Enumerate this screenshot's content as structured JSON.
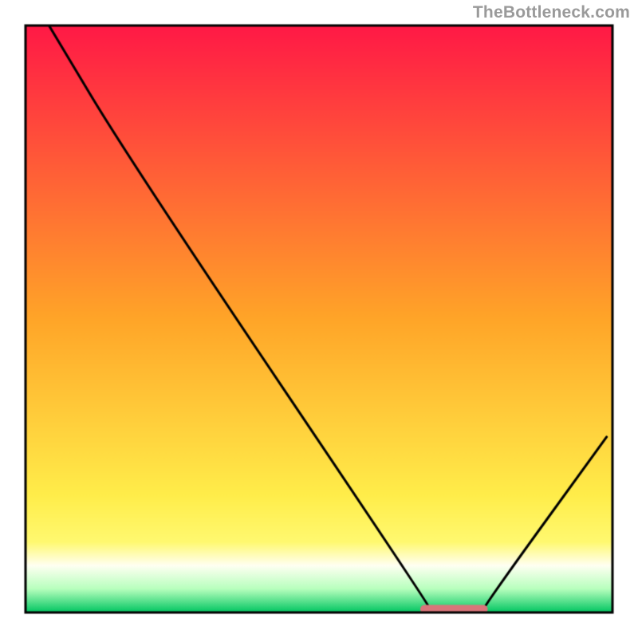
{
  "watermark": "TheBottleneck.com",
  "chart_data": {
    "type": "line",
    "title": "",
    "xlabel": "",
    "ylabel": "",
    "xlim": [
      0,
      100
    ],
    "ylim": [
      0,
      107
    ],
    "series": [
      {
        "name": "curve",
        "points": [
          {
            "x": 4,
            "y": 107
          },
          {
            "x": 18,
            "y": 82
          },
          {
            "x": 69,
            "y": 1
          },
          {
            "x": 69,
            "y": 0
          },
          {
            "x": 78,
            "y": 0
          },
          {
            "x": 78,
            "y": 1
          },
          {
            "x": 99,
            "y": 32
          }
        ]
      }
    ],
    "annotations": [
      {
        "name": "flat-marker",
        "x0": 68,
        "x1": 78,
        "y": 0,
        "color": "#d9757a"
      }
    ],
    "gradient": {
      "stops": [
        {
          "offset": 0.0,
          "color": "#ff1946"
        },
        {
          "offset": 0.5,
          "color": "#ffa528"
        },
        {
          "offset": 0.8,
          "color": "#ffed4a"
        },
        {
          "offset": 0.88,
          "color": "#fff970"
        },
        {
          "offset": 0.92,
          "color": "#fffff2"
        },
        {
          "offset": 0.96,
          "color": "#b7ffbd"
        },
        {
          "offset": 1.0,
          "color": "#00c561"
        }
      ]
    },
    "frame": {
      "inset": 32,
      "stroke": "#000000",
      "width": 3
    }
  }
}
